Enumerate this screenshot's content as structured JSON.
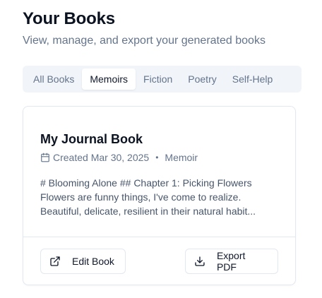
{
  "header": {
    "title": "Your Books",
    "subtitle": "View, manage, and export your generated books"
  },
  "tabs": [
    {
      "label": "All Books",
      "active": false
    },
    {
      "label": "Memoirs",
      "active": true
    },
    {
      "label": "Fiction",
      "active": false
    },
    {
      "label": "Poetry",
      "active": false
    },
    {
      "label": "Self-Help",
      "active": false
    }
  ],
  "book": {
    "title": "My Journal Book",
    "created": "Created Mar 30, 2025",
    "separator": "•",
    "category": "Memoir",
    "excerpt_lines": [
      "# Blooming Alone ## Chapter 1: Picking Flowers",
      "Flowers are funny things, I've come to realize.",
      "Beautiful, delicate, resilient in their natural habit..."
    ],
    "icons": {
      "calendar": "calendar-icon",
      "edit": "external-link-icon",
      "export": "download-icon"
    },
    "actions": {
      "edit_label": "Edit Book",
      "export_label": "Export PDF"
    }
  }
}
